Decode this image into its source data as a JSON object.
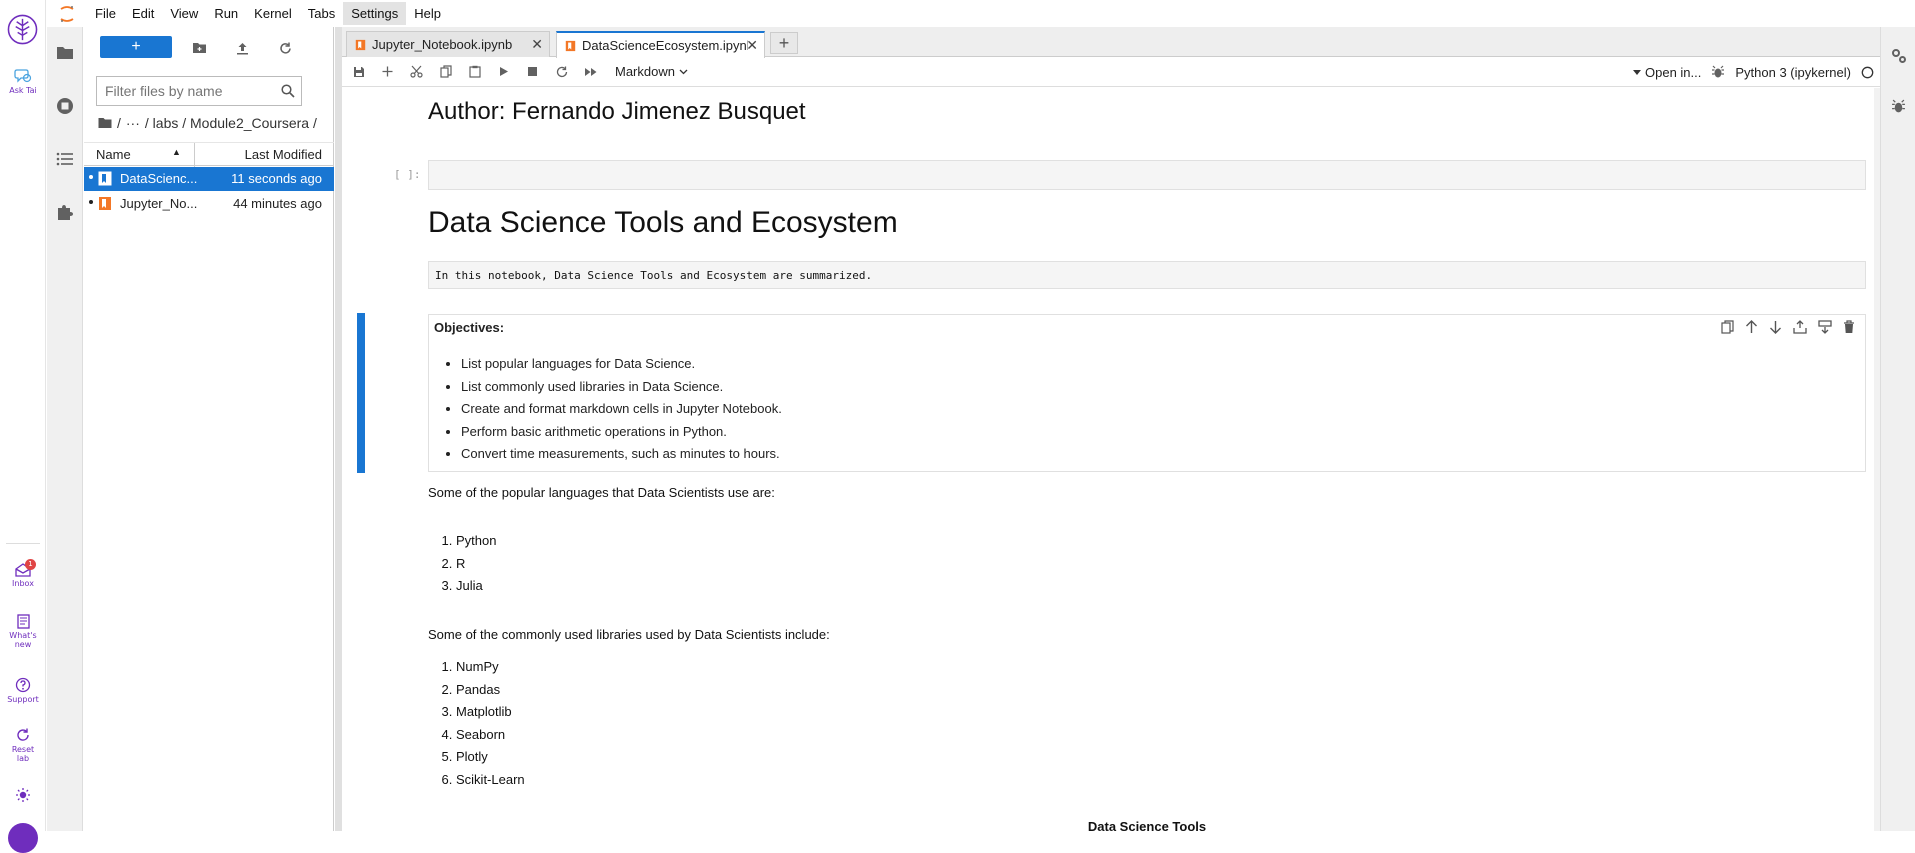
{
  "rail": {
    "ask_label": "Ask Tai",
    "inbox_label": "Inbox",
    "inbox_count": "1",
    "whats_new_label": "What's new",
    "support_label": "Support",
    "reset_label": "Reset lab"
  },
  "menubar": {
    "items": [
      "File",
      "Edit",
      "View",
      "Run",
      "Kernel",
      "Tabs",
      "Settings",
      "Help"
    ]
  },
  "filebrowser": {
    "new_label": "+",
    "filter_placeholder": "Filter files by name",
    "breadcrumb": [
      "/",
      "···",
      "/ labs / Module2_Coursera /"
    ],
    "col_name": "Name",
    "col_modified": "Last Modified",
    "files": [
      {
        "name": "DataScienceEcosystem.ipynb",
        "display": "DataScienc...",
        "modified": "11 seconds ago",
        "selected": true
      },
      {
        "name": "Jupyter_Notebook.ipynb",
        "display": "Jupyter_No...",
        "modified": "44 minutes ago",
        "selected": false
      }
    ]
  },
  "tabs": [
    {
      "label": "Jupyter_Notebook.ipynb",
      "active": false
    },
    {
      "label": "DataScienceEcosystem.ipynb",
      "active": true
    }
  ],
  "toolbar": {
    "cell_type": "Markdown",
    "open_in": "Open in...",
    "kernel": "Python 3 (ipykernel)"
  },
  "notebook": {
    "author": "Author: Fernando Jimenez Busquet",
    "empty_prompt": "[ ]:",
    "title": "Data Science Tools and Ecosystem",
    "intro": "In this notebook, Data Science Tools and Ecosystem are summarized.",
    "objectives_title": "Objectives:",
    "objectives": [
      "List popular languages for Data Science.",
      "List commonly used libraries in Data Science.",
      "Create and format markdown cells in Jupyter Notebook.",
      "Perform basic arithmetic operations in Python.",
      "Convert time measurements, such as minutes to hours."
    ],
    "languages_intro": "Some of the popular languages that Data Scientists use are:",
    "languages": [
      "Python",
      "R",
      "Julia"
    ],
    "libraries_intro": "Some of the commonly used libraries used by Data Scientists include:",
    "libraries": [
      "NumPy",
      "Pandas",
      "Matplotlib",
      "Seaborn",
      "Plotly",
      "Scikit-Learn"
    ],
    "tools_heading": "Data Science Tools"
  },
  "colors": {
    "accent": "#1976d2",
    "rail_purple": "#6f2dbd",
    "notebook_orange": "#f37726"
  }
}
